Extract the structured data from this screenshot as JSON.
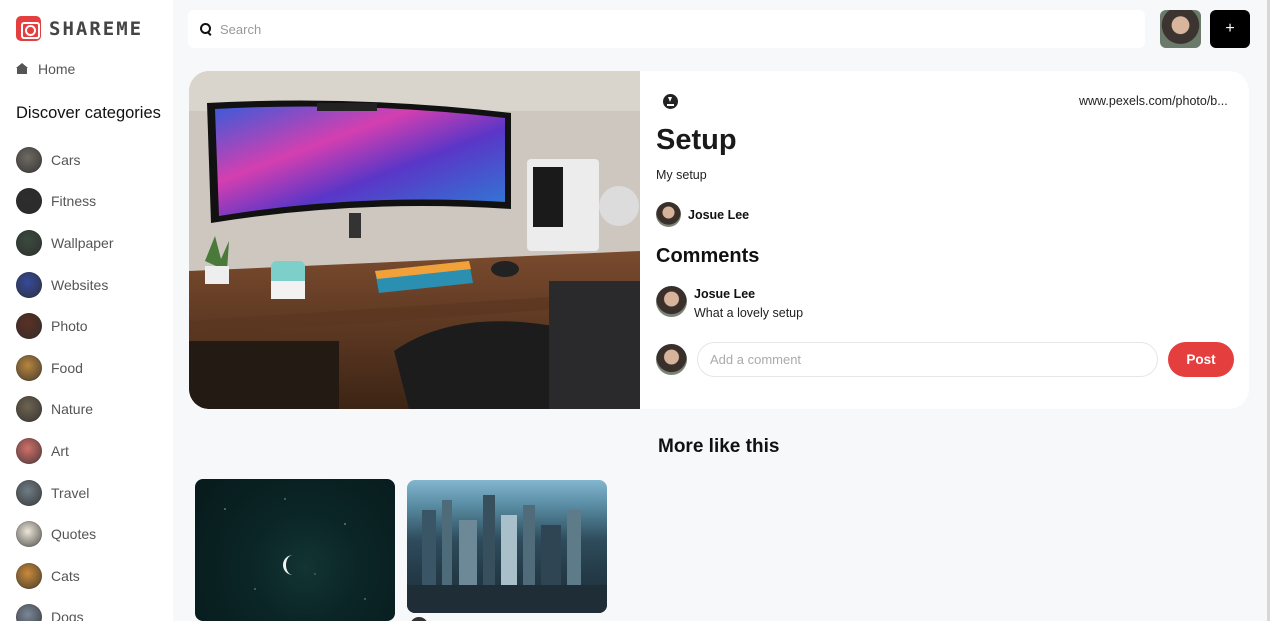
{
  "app": {
    "logo_text": "SHAREME",
    "accent": "#e53e3e"
  },
  "sidebar": {
    "home_label": "Home",
    "discover_title": "Discover categories",
    "categories": [
      {
        "label": "Cars",
        "color": "#6e6a63"
      },
      {
        "label": "Fitness",
        "color": "#2d2d2d"
      },
      {
        "label": "Wallpaper",
        "color": "#3a4a3f"
      },
      {
        "label": "Websites",
        "color": "#354a9a"
      },
      {
        "label": "Photo",
        "color": "#5a3024"
      },
      {
        "label": "Food",
        "color": "#b7853e"
      },
      {
        "label": "Nature",
        "color": "#6d6350"
      },
      {
        "label": "Art",
        "color": "#d1706a"
      },
      {
        "label": "Travel",
        "color": "#6f7c84"
      },
      {
        "label": "Quotes",
        "color": "#ece6d8"
      },
      {
        "label": "Cats",
        "color": "#c98a3a"
      },
      {
        "label": "Dogs",
        "color": "#7a8797"
      }
    ]
  },
  "topbar": {
    "search_placeholder": "Search",
    "add_label": "+"
  },
  "pin": {
    "source_url": "www.pexels.com/photo/b...",
    "title": "Setup",
    "description": "My setup",
    "author": "Josue Lee",
    "comments_heading": "Comments",
    "comments": [
      {
        "user": "Josue Lee",
        "text": "What a lovely setup"
      }
    ],
    "comment_placeholder": "Add a comment",
    "post_label": "Post"
  },
  "more": {
    "heading": "More like this"
  }
}
